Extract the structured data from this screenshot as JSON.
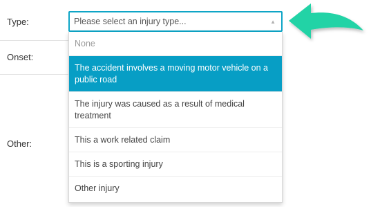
{
  "form": {
    "type_label": "Type:",
    "onset_label": "Onset:",
    "other_label": "Other:"
  },
  "injury_select": {
    "placeholder": "Please select an injury type...",
    "caret": "▲",
    "options": [
      "None",
      "The accident involves a moving motor vehicle on a public road",
      "The injury was caused as a result of medical treatment",
      "This a work related claim",
      "This is a sporting injury",
      "Other injury"
    ],
    "highlighted_index": 1
  },
  "colors": {
    "accent": "#0ea5c6",
    "highlight": "#079ec5",
    "arrow": "#22d3a6"
  },
  "annotation": {
    "icon": "curved-arrow-pointing-left"
  }
}
